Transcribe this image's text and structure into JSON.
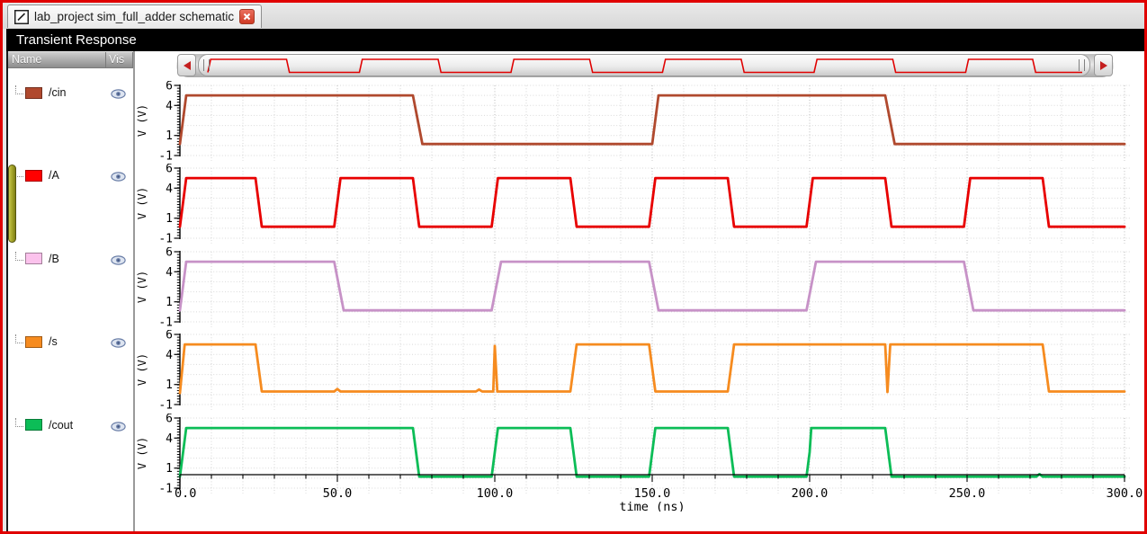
{
  "tab_bar": {
    "tab": {
      "title": "lab_project sim_full_adder schematic"
    }
  },
  "title_bar": {
    "title": "Transient Response"
  },
  "signal_panel": {
    "header": {
      "name": "Name",
      "vis": "Vis"
    },
    "signals": [
      {
        "name": "/cin",
        "swatch_color": "#b0492e",
        "visible": true
      },
      {
        "name": "/A",
        "swatch_color": "#ff0000",
        "visible": true
      },
      {
        "name": "/B",
        "swatch_color": "#fbc2ec",
        "visible": true
      },
      {
        "name": "/s",
        "swatch_color": "#f68b1f",
        "visible": true
      },
      {
        "name": "/cout",
        "swatch_color": "#0cbd57",
        "visible": true
      }
    ]
  },
  "overview_scrollbar": {
    "preview_color": "#e00000",
    "preview_points": [
      [
        0,
        0
      ],
      [
        1,
        1
      ],
      [
        27,
        1
      ],
      [
        28,
        0
      ],
      [
        52,
        0
      ],
      [
        53,
        1
      ],
      [
        79,
        1
      ],
      [
        80,
        0
      ],
      [
        104,
        0
      ],
      [
        105,
        1
      ],
      [
        131,
        1
      ],
      [
        132,
        0
      ],
      [
        156,
        0
      ],
      [
        157,
        1
      ],
      [
        183,
        1
      ],
      [
        184,
        0
      ],
      [
        208,
        0
      ],
      [
        209,
        1
      ],
      [
        235,
        1
      ],
      [
        236,
        0
      ],
      [
        260,
        0
      ],
      [
        261,
        1
      ],
      [
        283,
        1
      ],
      [
        284,
        0
      ],
      [
        300,
        0
      ]
    ]
  },
  "chart_data": {
    "type": "line",
    "title": "Transient Response",
    "xlabel": "time (ns)",
    "ylabel": "V (V)",
    "xlim": [
      0,
      300
    ],
    "ylim": [
      -1,
      6
    ],
    "xticks": [
      0,
      50,
      100,
      150,
      200,
      250,
      300
    ],
    "xtick_labels": [
      "0.0",
      "50.0",
      "100.0",
      "150.0",
      "200.0",
      "250.0",
      "300.0"
    ],
    "x_minor_step": 10,
    "yticks": [
      6,
      4,
      1,
      -1
    ],
    "ytick_labels": [
      "6",
      "4",
      "1",
      "-1"
    ],
    "grid": true,
    "legend_position": "left-panel",
    "series": [
      {
        "name": "/cin",
        "color": "#b0492e",
        "points": [
          [
            0,
            0.15
          ],
          [
            2,
            5
          ],
          [
            74,
            5
          ],
          [
            77,
            0.15
          ],
          [
            150,
            0.15
          ],
          [
            152,
            5
          ],
          [
            224,
            5
          ],
          [
            227,
            0.15
          ],
          [
            300,
            0.15
          ]
        ]
      },
      {
        "name": "/A",
        "color": "#e80000",
        "points": [
          [
            0,
            0.15
          ],
          [
            2,
            5
          ],
          [
            24,
            5
          ],
          [
            26,
            0.15
          ],
          [
            49,
            0.15
          ],
          [
            51,
            5
          ],
          [
            74,
            5
          ],
          [
            76,
            0.15
          ],
          [
            99,
            0.15
          ],
          [
            101,
            5
          ],
          [
            124,
            5
          ],
          [
            126,
            0.15
          ],
          [
            149,
            0.15
          ],
          [
            151,
            5
          ],
          [
            174,
            5
          ],
          [
            176,
            0.15
          ],
          [
            199,
            0.15
          ],
          [
            201,
            5
          ],
          [
            224,
            5
          ],
          [
            226,
            0.15
          ],
          [
            249,
            0.15
          ],
          [
            251,
            5
          ],
          [
            274,
            5
          ],
          [
            276,
            0.15
          ],
          [
            300,
            0.15
          ]
        ]
      },
      {
        "name": "/B",
        "color": "#c792c7",
        "points": [
          [
            0,
            0.15
          ],
          [
            2,
            5
          ],
          [
            49,
            5
          ],
          [
            52,
            0.15
          ],
          [
            99,
            0.15
          ],
          [
            102,
            5
          ],
          [
            149,
            5
          ],
          [
            152,
            0.15
          ],
          [
            199,
            0.15
          ],
          [
            202,
            5
          ],
          [
            249,
            5
          ],
          [
            252,
            0.15
          ],
          [
            300,
            0.15
          ]
        ]
      },
      {
        "name": "/s",
        "color": "#f68b1f",
        "points": [
          [
            0,
            0.15
          ],
          [
            1.5,
            5
          ],
          [
            24,
            5
          ],
          [
            26,
            0.3
          ],
          [
            49,
            0.3
          ],
          [
            50,
            0.55
          ],
          [
            51,
            0.3
          ],
          [
            94,
            0.3
          ],
          [
            95,
            0.5
          ],
          [
            96,
            0.3
          ],
          [
            99.5,
            0.3
          ],
          [
            100,
            4.85
          ],
          [
            100.8,
            0.3
          ],
          [
            124,
            0.3
          ],
          [
            126,
            5
          ],
          [
            149,
            5
          ],
          [
            151,
            0.3
          ],
          [
            174,
            0.3
          ],
          [
            176,
            5
          ],
          [
            224,
            5
          ],
          [
            224.7,
            0.25
          ],
          [
            225.6,
            5
          ],
          [
            274,
            5
          ],
          [
            276,
            0.3
          ],
          [
            300,
            0.3
          ]
        ]
      },
      {
        "name": "/cout",
        "color": "#0cbd57",
        "points": [
          [
            0,
            0.15
          ],
          [
            2,
            5
          ],
          [
            74,
            5
          ],
          [
            76,
            0.15
          ],
          [
            99,
            0.15
          ],
          [
            101,
            5
          ],
          [
            124,
            5
          ],
          [
            126,
            0.15
          ],
          [
            149,
            0.15
          ],
          [
            151,
            5
          ],
          [
            174,
            5
          ],
          [
            176,
            0.15
          ],
          [
            199,
            0.15
          ],
          [
            200,
            2.6
          ],
          [
            200.5,
            5
          ],
          [
            224,
            5
          ],
          [
            226,
            0.15
          ],
          [
            272,
            0.15
          ],
          [
            273,
            0.4
          ],
          [
            274,
            0.15
          ],
          [
            300,
            0.15
          ]
        ]
      }
    ]
  }
}
